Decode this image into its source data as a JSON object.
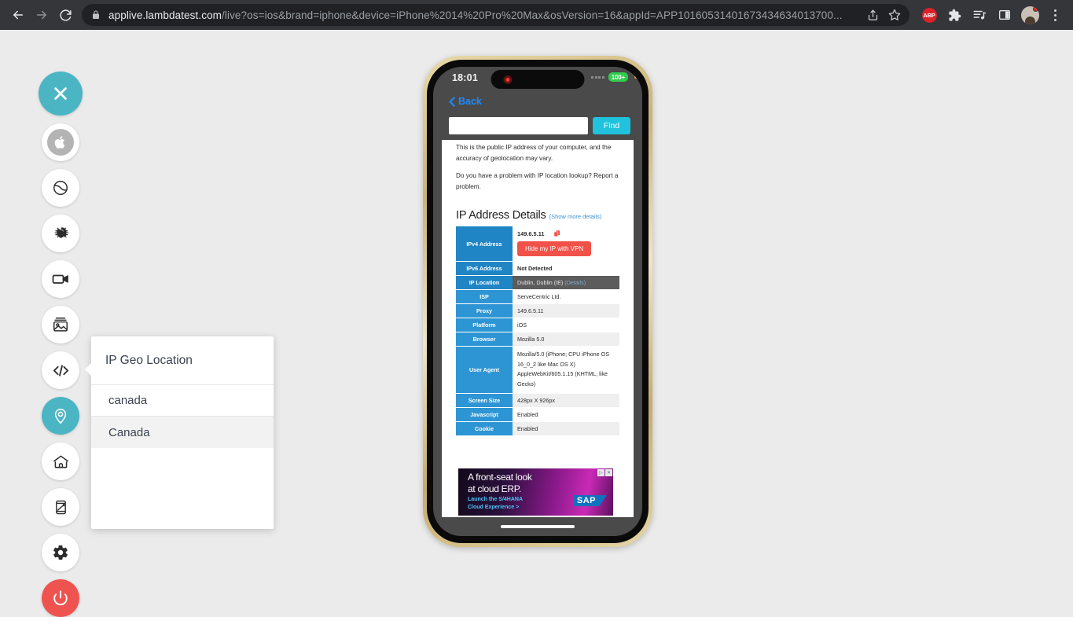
{
  "browser": {
    "back_icon": "back-arrow-icon",
    "forward_icon": "forward-arrow-icon",
    "reload_icon": "reload-icon",
    "lock_icon": "lock-icon",
    "url_host": "applive.lambdatest.com",
    "url_path": "/live?os=ios&brand=iphone&device=iPhone%2014%20Pro%20Max&osVersion=16&appId=APP10160531401673434634013700...",
    "url_full": "applive.lambdatest.com/live?os=ios&brand=iphone&device=iPhone%2014%20Pro%20Max&osVersion=16&appId=APP10160531401673434634013700...",
    "share_icon": "share-icon",
    "bookmark_icon": "star-icon",
    "extensions": [
      {
        "name": "abp-extension-icon",
        "label": "ABP"
      },
      {
        "name": "puzzle-extension-icon",
        "label": ""
      },
      {
        "name": "reading-list-icon",
        "label": ""
      },
      {
        "name": "side-panel-icon",
        "label": ""
      }
    ],
    "avatar_name": "profile-avatar",
    "menu_icon": "three-dot-menu-icon"
  },
  "toolbar": {
    "items": [
      {
        "name": "close-session-button",
        "icon": "close-x-icon",
        "style": "close",
        "label": "Close"
      },
      {
        "name": "os-selector-button",
        "icon": "apple-icon",
        "style": "os",
        "label": "iOS"
      },
      {
        "name": "switch-device-button",
        "icon": "switch-device-icon",
        "style": "plain",
        "label": "Switch"
      },
      {
        "name": "report-bug-button",
        "icon": "bug-icon",
        "style": "plain",
        "label": "Bug"
      },
      {
        "name": "record-video-button",
        "icon": "video-camera-icon",
        "style": "plain",
        "label": "Record"
      },
      {
        "name": "screenshot-button",
        "icon": "image-gallery-icon",
        "style": "plain",
        "label": "Screenshot"
      },
      {
        "name": "dev-tools-button",
        "icon": "code-icon",
        "style": "plain",
        "label": "DevTools"
      },
      {
        "name": "geo-location-button",
        "icon": "location-pin-icon",
        "style": "active",
        "label": "IP Geo Location"
      },
      {
        "name": "home-button",
        "icon": "home-icon",
        "style": "plain",
        "label": "Home"
      },
      {
        "name": "device-rotate-button",
        "icon": "rotate-device-icon",
        "style": "plain",
        "label": "Rotate"
      },
      {
        "name": "settings-button",
        "icon": "gear-icon",
        "style": "plain",
        "label": "Settings"
      },
      {
        "name": "power-button",
        "icon": "power-icon",
        "style": "power",
        "label": "Stop"
      }
    ]
  },
  "geo_panel": {
    "title": "IP Geo Location",
    "input_value": "canada",
    "input_placeholder": "",
    "options": [
      "Canada"
    ]
  },
  "device": {
    "status_bar": {
      "time": "18:01",
      "recording_indicator": "record-dot-icon",
      "signal_icon": "signal-bars-icon",
      "battery_label": "100+"
    },
    "nav": {
      "back_label": "Back"
    },
    "find_bar": {
      "input_value": "",
      "input_placeholder": "",
      "button_label": "Find"
    },
    "web_page": {
      "paragraph_1": "This is the public IP address of your computer, and the accuracy of geolocation may vary.",
      "paragraph_2": "Do you have a problem with IP location lookup? Report a problem.",
      "heading": "IP Address Details",
      "heading_link": "(Show more details)",
      "table": [
        {
          "key": "IPv4 Address",
          "value": "149.6.5.11",
          "copy_icon": "copy-icon",
          "button": "Hide my IP with VPN",
          "style": "white"
        },
        {
          "key": "IPv6 Address",
          "value": "Not Detected",
          "style": "white"
        },
        {
          "key": "IP Location",
          "value": "Dublin, Dublin (IE)",
          "link": "(Details)",
          "style": "selected"
        },
        {
          "key": "ISP",
          "value": "ServeCentric Ltd.",
          "style": "white"
        },
        {
          "key": "Proxy",
          "value": "149.6.5.11",
          "style": "grey"
        },
        {
          "key": "Platform",
          "value": "iOS",
          "style": "white"
        },
        {
          "key": "Browser",
          "value": "Mozilla 5.0",
          "style": "grey"
        },
        {
          "key": "User Agent",
          "value": "Mozilla/5.0 (iPhone; CPU iPhone OS 16_0_2 like Mac OS X) AppleWebKit/605.1.15 (KHTML, like Gecko)",
          "style": "white"
        },
        {
          "key": "Screen Size",
          "value": "428px X 926px",
          "style": "grey"
        },
        {
          "key": "Javascript",
          "value": "Enabled",
          "style": "white"
        },
        {
          "key": "Cookie",
          "value": "Enabled",
          "style": "grey"
        }
      ],
      "ad": {
        "line1": "A front-seat look",
        "line2": "at cloud ERP.",
        "line3": "Launch the S/4HANA",
        "line4": "Cloud Experience >",
        "brand": "SAP",
        "choices_1": "▷",
        "choices_2": "✕"
      }
    }
  }
}
